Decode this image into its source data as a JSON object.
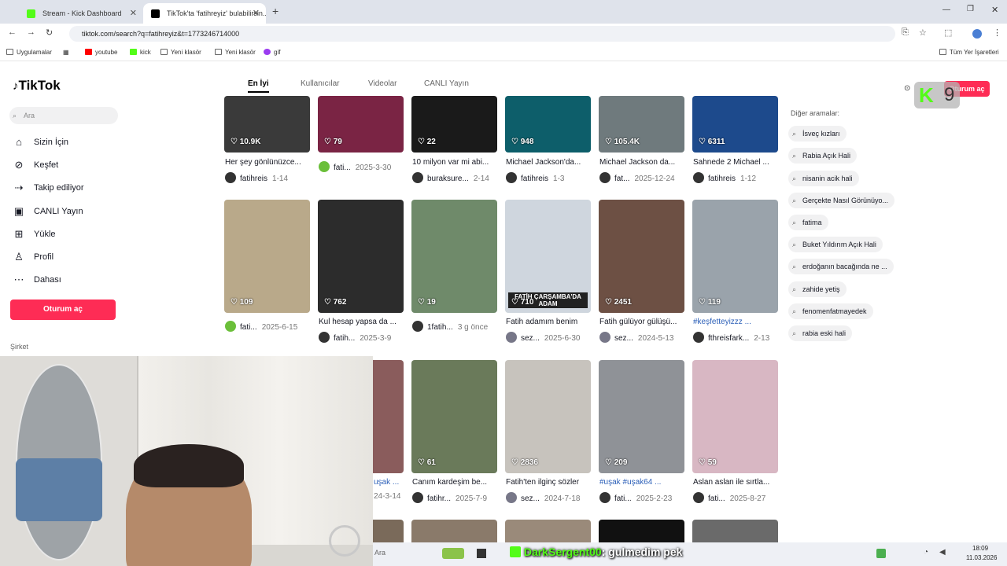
{
  "browser": {
    "tabs": [
      {
        "title": "Stream - Kick Dashboard",
        "favicon_color": "#53fc18"
      },
      {
        "title": "TikTok'ta 'fatihreyiz' bulabilirsin...",
        "favicon_color": "#000000"
      }
    ],
    "new_tab_symbol": "+",
    "url": "tiktok.com/search?q=fatihreyiz&t=1773246714000",
    "bookmarks": [
      "Uygulamalar",
      "youtube",
      "kick",
      "Yeni klasör",
      "Yeni klasör",
      "gif"
    ],
    "bookmarks_right": "Tüm Yer İşaretleri"
  },
  "tiktok": {
    "logo": "TikTok",
    "search_placeholder": "Ara",
    "nav": [
      {
        "label": "Sizin İçin",
        "icon": "home-icon"
      },
      {
        "label": "Keşfet",
        "icon": "compass-icon"
      },
      {
        "label": "Takip ediliyor",
        "icon": "following-icon"
      },
      {
        "label": "CANLI Yayın",
        "icon": "live-icon"
      },
      {
        "label": "Yükle",
        "icon": "upload-icon"
      },
      {
        "label": "Profil",
        "icon": "profile-icon"
      },
      {
        "label": "Dahası",
        "icon": "more-icon"
      }
    ],
    "login_button": "Oturum aç",
    "company": "Şirket",
    "top_login": "Oturum aç",
    "search_tabs": [
      "En İyi",
      "Kullanıcılar",
      "Videolar",
      "CANLI Yayın"
    ],
    "active_tab": "En İyi",
    "also_searched_title": "Diğer aramalar:",
    "also_searched": [
      "İsveç kızları",
      "Rabia Açık Hali",
      "nisanin acik hali",
      "Gerçekte Nasıl Görünüyo...",
      "fatima",
      "Buket Yıldırım Açık Hali",
      "erdoğanın bacağında ne ...",
      "zahide yetiş",
      "fenomenfatmayedek",
      "rabia eski hali"
    ]
  },
  "videos": {
    "row1": [
      {
        "likes": "10.9K",
        "desc": "Her şey gönlünüzce...",
        "author": "fatihreis",
        "date": "1-14",
        "bg": "#3a3a3a"
      },
      {
        "likes": "79",
        "desc": "",
        "author": "fati...",
        "date": "2025-3-30",
        "bg": "#7a2444"
      },
      {
        "likes": "22",
        "desc": "10 milyon var mi abi...",
        "author": "buraksure...",
        "date": "2-14",
        "bg": "#1a1a1a"
      },
      {
        "likes": "948",
        "desc": "Michael Jackson'da...",
        "author": "fatihreis",
        "date": "1-3",
        "bg": "#0d5e6a"
      },
      {
        "likes": "105.4K",
        "desc": "Michael Jackson da...",
        "author": "fat...",
        "date": "2025-12-24",
        "bg": "#6f7a7d"
      },
      {
        "likes": "6311",
        "desc": "Sahnede 2 Michael ...",
        "author": "fatihreis",
        "date": "1-12",
        "bg": "#1d4a8c"
      }
    ],
    "row2": [
      {
        "likes": "109",
        "desc": "",
        "author": "fati...",
        "date": "2025-6-15",
        "bg": "#b9a98a"
      },
      {
        "likes": "762",
        "desc": "Kul hesap yapsa da ...",
        "author": "fatih...",
        "date": "2025-3-9",
        "bg": "#2c2c2c"
      },
      {
        "likes": "19",
        "desc": "",
        "author": "1fatih...",
        "date": "3 g önce",
        "bg": "#6f8a6a"
      },
      {
        "likes": "710",
        "desc": "Fatih adamım benim",
        "author": "sez...",
        "date": "2025-6-30",
        "bg": "#cfd6de",
        "caption": "FATİH ÇARŞAMBA'DA ADAM"
      },
      {
        "likes": "2451",
        "desc": "Fatih gülüyor gülüşü...",
        "author": "sez...",
        "date": "2024-5-13",
        "bg": "#6d5044"
      },
      {
        "likes": "119",
        "desc": "#keşfetteyizzz ...",
        "author": "fthreisfark...",
        "date": "2-13",
        "bg": "#9aa3ab"
      }
    ],
    "row3": [
      {
        "likes": "",
        "desc": "uşak ...",
        "author": "",
        "date": "24-3-14",
        "bg": "#8a5c5c"
      },
      {
        "likes": "61",
        "desc": "Canım kardeşim be...",
        "author": "fatihr...",
        "date": "2025-7-9",
        "bg": "#6a7a5a"
      },
      {
        "likes": "2836",
        "desc": "Fatih'ten ilginç sözler",
        "author": "sez...",
        "date": "2024-7-18",
        "bg": "#c7c3bd"
      },
      {
        "likes": "209",
        "desc": "#uşak #uşak64 ...",
        "author": "fati...",
        "date": "2025-2-23",
        "bg": "#8f9297"
      },
      {
        "likes": "59",
        "desc": "Aslan aslan ile sırtla...",
        "author": "fati...",
        "date": "2025-8-27",
        "bg": "#d8b7c3"
      }
    ]
  },
  "overlay": {
    "chat_user": "DarkSergent00",
    "chat_message": ": gulmedim pek",
    "taskbar_search": "Ara",
    "clock_time": "18:09",
    "clock_date": "11.03.2026"
  }
}
